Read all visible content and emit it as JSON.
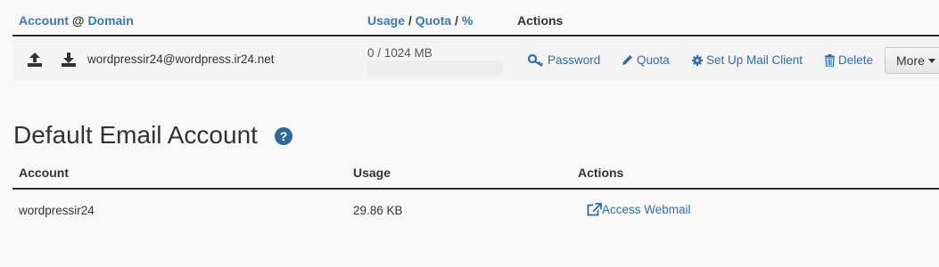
{
  "top_table": {
    "col_account": "Account",
    "col_at": "@",
    "col_domain": "Domain",
    "col_usage": "Usage",
    "col_slash1": "/",
    "col_quota": "Quota",
    "col_slash2": "/",
    "col_percent": "%",
    "col_actions": "Actions",
    "row": {
      "account": "wordpressir24@wordpress.ir24.net",
      "usage_text": "0 / 1024 MB",
      "usage_fraction": 0,
      "actions": {
        "password": "Password",
        "quota": "Quota",
        "setup_mail": "Set Up Mail Client",
        "delete": "Delete",
        "more": "More"
      }
    }
  },
  "default_section": {
    "title": "Default Email Account",
    "col_account": "Account",
    "col_usage": "Usage",
    "col_actions": "Actions",
    "row": {
      "account": "wordpressir24",
      "usage": "29.86 KB",
      "webmail": "Access Webmail"
    }
  },
  "colors": {
    "link": "#2a6db0",
    "header_blue": "#3a78b5",
    "help_icon": "#2d6a97"
  },
  "icons": [
    "upload-icon",
    "download-icon",
    "key-icon",
    "pencil-icon",
    "gear-icon",
    "trash-icon",
    "caret-down-icon",
    "help-icon",
    "external-link-icon"
  ]
}
